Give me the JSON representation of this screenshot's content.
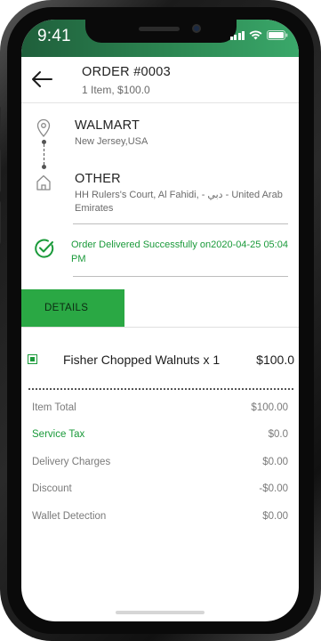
{
  "status_bar": {
    "time": "9:41",
    "icons": [
      "signal-icon",
      "wifi-icon",
      "battery-icon"
    ]
  },
  "header": {
    "title": "ORDER #0003",
    "subtitle": "1 Item, $100.0",
    "back_icon": "back-arrow-icon"
  },
  "route": {
    "pickup": {
      "name": "WALMART",
      "address": "New Jersey,USA",
      "icon": "location-pin-icon"
    },
    "drop": {
      "name": "OTHER",
      "address": "HH Rulers's Court, Al Fahidi, - دبي - United Arab Emirates",
      "icon": "home-icon"
    }
  },
  "delivery": {
    "status_text": "Order Delivered Successfully on2020-04-25 05:04 PM",
    "icon": "check-circle-icon"
  },
  "tabs": {
    "details_label": "DETAILS"
  },
  "items": [
    {
      "name": "Fisher Chopped Walnuts x 1",
      "price": "$100.0"
    }
  ],
  "summary": [
    {
      "label": "Item Total",
      "value": "$100.00",
      "accent": false
    },
    {
      "label": "Service Tax",
      "value": "$0.0",
      "accent": true
    },
    {
      "label": "Delivery Charges",
      "value": "$0.00",
      "accent": false
    },
    {
      "label": "Discount",
      "value": "-$0.00",
      "accent": false
    },
    {
      "label": "Wallet Detection",
      "value": "$0.00",
      "accent": false
    }
  ],
  "colors": {
    "brand_green": "#2aa844",
    "status_green": "#1a9a3a",
    "status_bar_gradient_start": "#1f5f3b",
    "status_bar_gradient_end": "#3aa86a"
  }
}
